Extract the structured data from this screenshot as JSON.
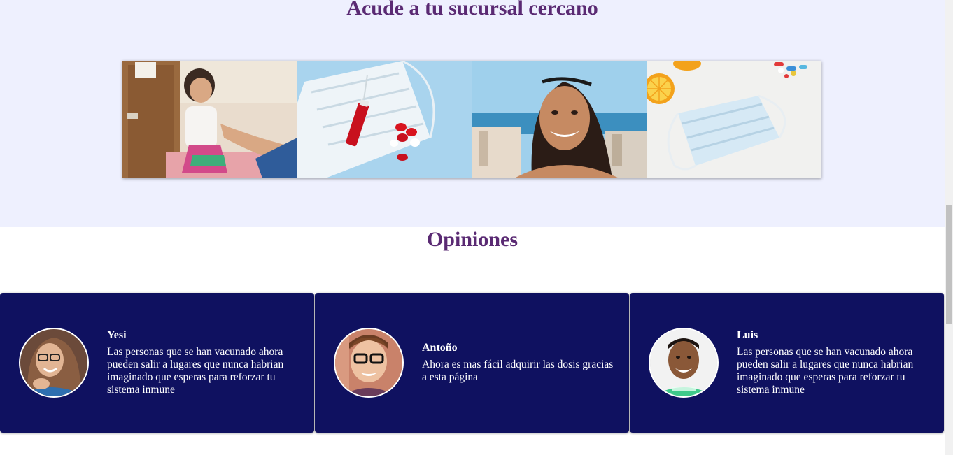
{
  "sucursal": {
    "title": "Acude a tu sucursal cercano"
  },
  "gallery": [
    {
      "icon": "child-vaccination-photo"
    },
    {
      "icon": "mask-syringe-photo"
    },
    {
      "icon": "smiling-woman-photo"
    },
    {
      "icon": "mask-lemon-pills-photo"
    }
  ],
  "opiniones": {
    "title": "Opiniones",
    "reviews": [
      {
        "name": "Yesi",
        "text": "Las personas que se han vacunado ahora pueden salir a lugares que nunca habrian imaginado que esperas para reforzar tu sistema inmune"
      },
      {
        "name": "Antoño",
        "text": "Ahora es mas fácil adquirir las dosis gracias a esta página"
      },
      {
        "name": "Luis",
        "text": "Las personas que se han vacunado ahora pueden salir a lugares que nunca habrian imaginado que esperas para reforzar tu sistema inmune"
      }
    ]
  },
  "colors": {
    "section_bg": "#eef0fe",
    "heading": "#5a2a73",
    "card_bg": "#0f1160"
  }
}
